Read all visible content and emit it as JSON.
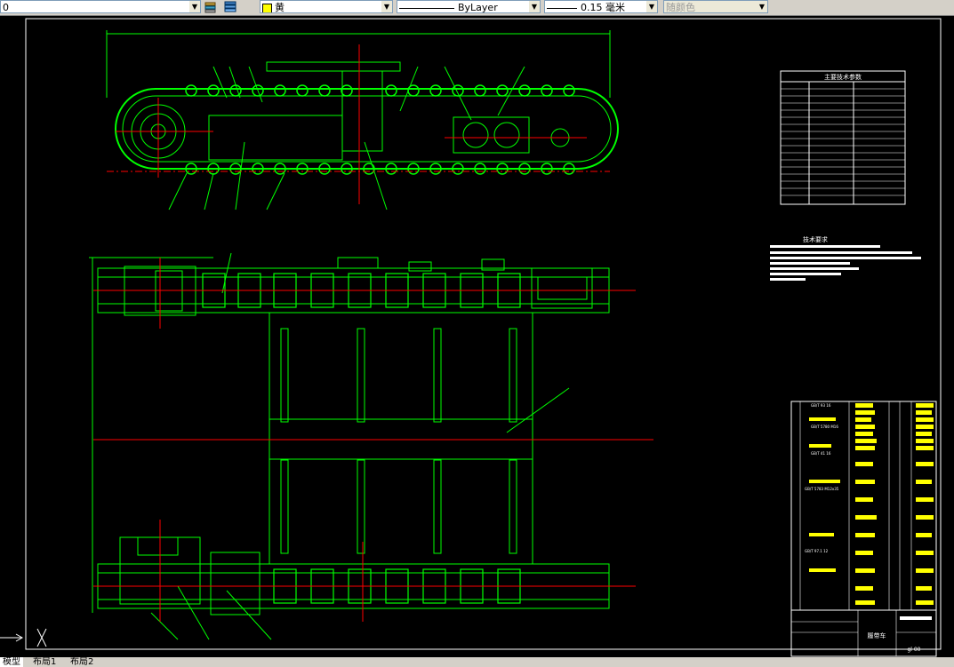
{
  "toolbar": {
    "layer_combo": "0",
    "color_combo": "黄",
    "linetype_combo": "ByLayer",
    "lineweight_combo": "0.15 毫米",
    "plotstyle_combo": "随颜色",
    "icons": [
      "layer-previous-icon",
      "layer-states-icon"
    ]
  },
  "colors": {
    "drawing_line": "#00ff00",
    "center_line": "#ff0000",
    "frame_line": "#ffffff",
    "annotation": "#ffff00",
    "background": "#000000"
  },
  "drawing": {
    "tech_table_title": "主要技术参数",
    "tech_requirements_title": "技术要求",
    "title_block_name": "履带车",
    "title_block_drawing_no": "gl 00",
    "parts_list_items": [
      "GB/T 93 16",
      "GB/T 5780 M16",
      "GB/T 41 16",
      "GB/T 5783 M12x35",
      "GB/T 97.1 12"
    ],
    "tech_requirements_lines": [
      "1",
      "2",
      "3",
      "4",
      "5",
      "6"
    ]
  },
  "tabs": [
    "模型",
    "布局1",
    "布局2"
  ]
}
